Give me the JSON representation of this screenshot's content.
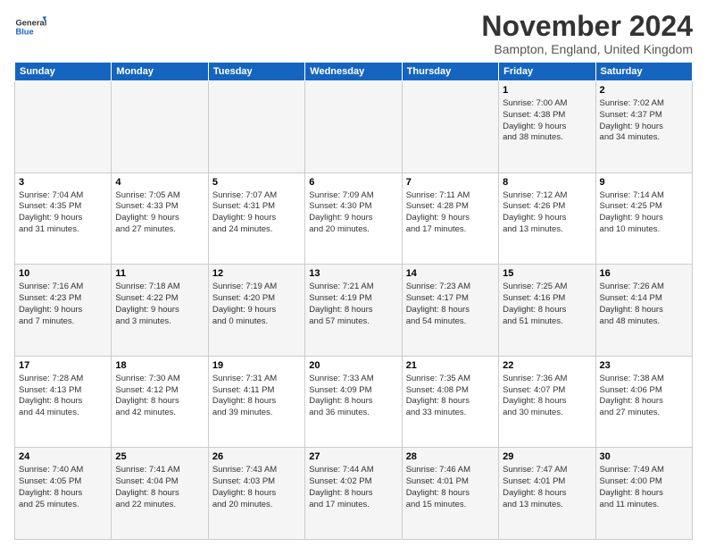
{
  "header": {
    "logo_general": "General",
    "logo_blue": "Blue",
    "month_title": "November 2024",
    "location": "Bampton, England, United Kingdom"
  },
  "days_of_week": [
    "Sunday",
    "Monday",
    "Tuesday",
    "Wednesday",
    "Thursday",
    "Friday",
    "Saturday"
  ],
  "weeks": [
    [
      {
        "day": "",
        "detail": ""
      },
      {
        "day": "",
        "detail": ""
      },
      {
        "day": "",
        "detail": ""
      },
      {
        "day": "",
        "detail": ""
      },
      {
        "day": "",
        "detail": ""
      },
      {
        "day": "1",
        "detail": "Sunrise: 7:00 AM\nSunset: 4:38 PM\nDaylight: 9 hours\nand 38 minutes."
      },
      {
        "day": "2",
        "detail": "Sunrise: 7:02 AM\nSunset: 4:37 PM\nDaylight: 9 hours\nand 34 minutes."
      }
    ],
    [
      {
        "day": "3",
        "detail": "Sunrise: 7:04 AM\nSunset: 4:35 PM\nDaylight: 9 hours\nand 31 minutes."
      },
      {
        "day": "4",
        "detail": "Sunrise: 7:05 AM\nSunset: 4:33 PM\nDaylight: 9 hours\nand 27 minutes."
      },
      {
        "day": "5",
        "detail": "Sunrise: 7:07 AM\nSunset: 4:31 PM\nDaylight: 9 hours\nand 24 minutes."
      },
      {
        "day": "6",
        "detail": "Sunrise: 7:09 AM\nSunset: 4:30 PM\nDaylight: 9 hours\nand 20 minutes."
      },
      {
        "day": "7",
        "detail": "Sunrise: 7:11 AM\nSunset: 4:28 PM\nDaylight: 9 hours\nand 17 minutes."
      },
      {
        "day": "8",
        "detail": "Sunrise: 7:12 AM\nSunset: 4:26 PM\nDaylight: 9 hours\nand 13 minutes."
      },
      {
        "day": "9",
        "detail": "Sunrise: 7:14 AM\nSunset: 4:25 PM\nDaylight: 9 hours\nand 10 minutes."
      }
    ],
    [
      {
        "day": "10",
        "detail": "Sunrise: 7:16 AM\nSunset: 4:23 PM\nDaylight: 9 hours\nand 7 minutes."
      },
      {
        "day": "11",
        "detail": "Sunrise: 7:18 AM\nSunset: 4:22 PM\nDaylight: 9 hours\nand 3 minutes."
      },
      {
        "day": "12",
        "detail": "Sunrise: 7:19 AM\nSunset: 4:20 PM\nDaylight: 9 hours\nand 0 minutes."
      },
      {
        "day": "13",
        "detail": "Sunrise: 7:21 AM\nSunset: 4:19 PM\nDaylight: 8 hours\nand 57 minutes."
      },
      {
        "day": "14",
        "detail": "Sunrise: 7:23 AM\nSunset: 4:17 PM\nDaylight: 8 hours\nand 54 minutes."
      },
      {
        "day": "15",
        "detail": "Sunrise: 7:25 AM\nSunset: 4:16 PM\nDaylight: 8 hours\nand 51 minutes."
      },
      {
        "day": "16",
        "detail": "Sunrise: 7:26 AM\nSunset: 4:14 PM\nDaylight: 8 hours\nand 48 minutes."
      }
    ],
    [
      {
        "day": "17",
        "detail": "Sunrise: 7:28 AM\nSunset: 4:13 PM\nDaylight: 8 hours\nand 44 minutes."
      },
      {
        "day": "18",
        "detail": "Sunrise: 7:30 AM\nSunset: 4:12 PM\nDaylight: 8 hours\nand 42 minutes."
      },
      {
        "day": "19",
        "detail": "Sunrise: 7:31 AM\nSunset: 4:11 PM\nDaylight: 8 hours\nand 39 minutes."
      },
      {
        "day": "20",
        "detail": "Sunrise: 7:33 AM\nSunset: 4:09 PM\nDaylight: 8 hours\nand 36 minutes."
      },
      {
        "day": "21",
        "detail": "Sunrise: 7:35 AM\nSunset: 4:08 PM\nDaylight: 8 hours\nand 33 minutes."
      },
      {
        "day": "22",
        "detail": "Sunrise: 7:36 AM\nSunset: 4:07 PM\nDaylight: 8 hours\nand 30 minutes."
      },
      {
        "day": "23",
        "detail": "Sunrise: 7:38 AM\nSunset: 4:06 PM\nDaylight: 8 hours\nand 27 minutes."
      }
    ],
    [
      {
        "day": "24",
        "detail": "Sunrise: 7:40 AM\nSunset: 4:05 PM\nDaylight: 8 hours\nand 25 minutes."
      },
      {
        "day": "25",
        "detail": "Sunrise: 7:41 AM\nSunset: 4:04 PM\nDaylight: 8 hours\nand 22 minutes."
      },
      {
        "day": "26",
        "detail": "Sunrise: 7:43 AM\nSunset: 4:03 PM\nDaylight: 8 hours\nand 20 minutes."
      },
      {
        "day": "27",
        "detail": "Sunrise: 7:44 AM\nSunset: 4:02 PM\nDaylight: 8 hours\nand 17 minutes."
      },
      {
        "day": "28",
        "detail": "Sunrise: 7:46 AM\nSunset: 4:01 PM\nDaylight: 8 hours\nand 15 minutes."
      },
      {
        "day": "29",
        "detail": "Sunrise: 7:47 AM\nSunset: 4:01 PM\nDaylight: 8 hours\nand 13 minutes."
      },
      {
        "day": "30",
        "detail": "Sunrise: 7:49 AM\nSunset: 4:00 PM\nDaylight: 8 hours\nand 11 minutes."
      }
    ]
  ]
}
